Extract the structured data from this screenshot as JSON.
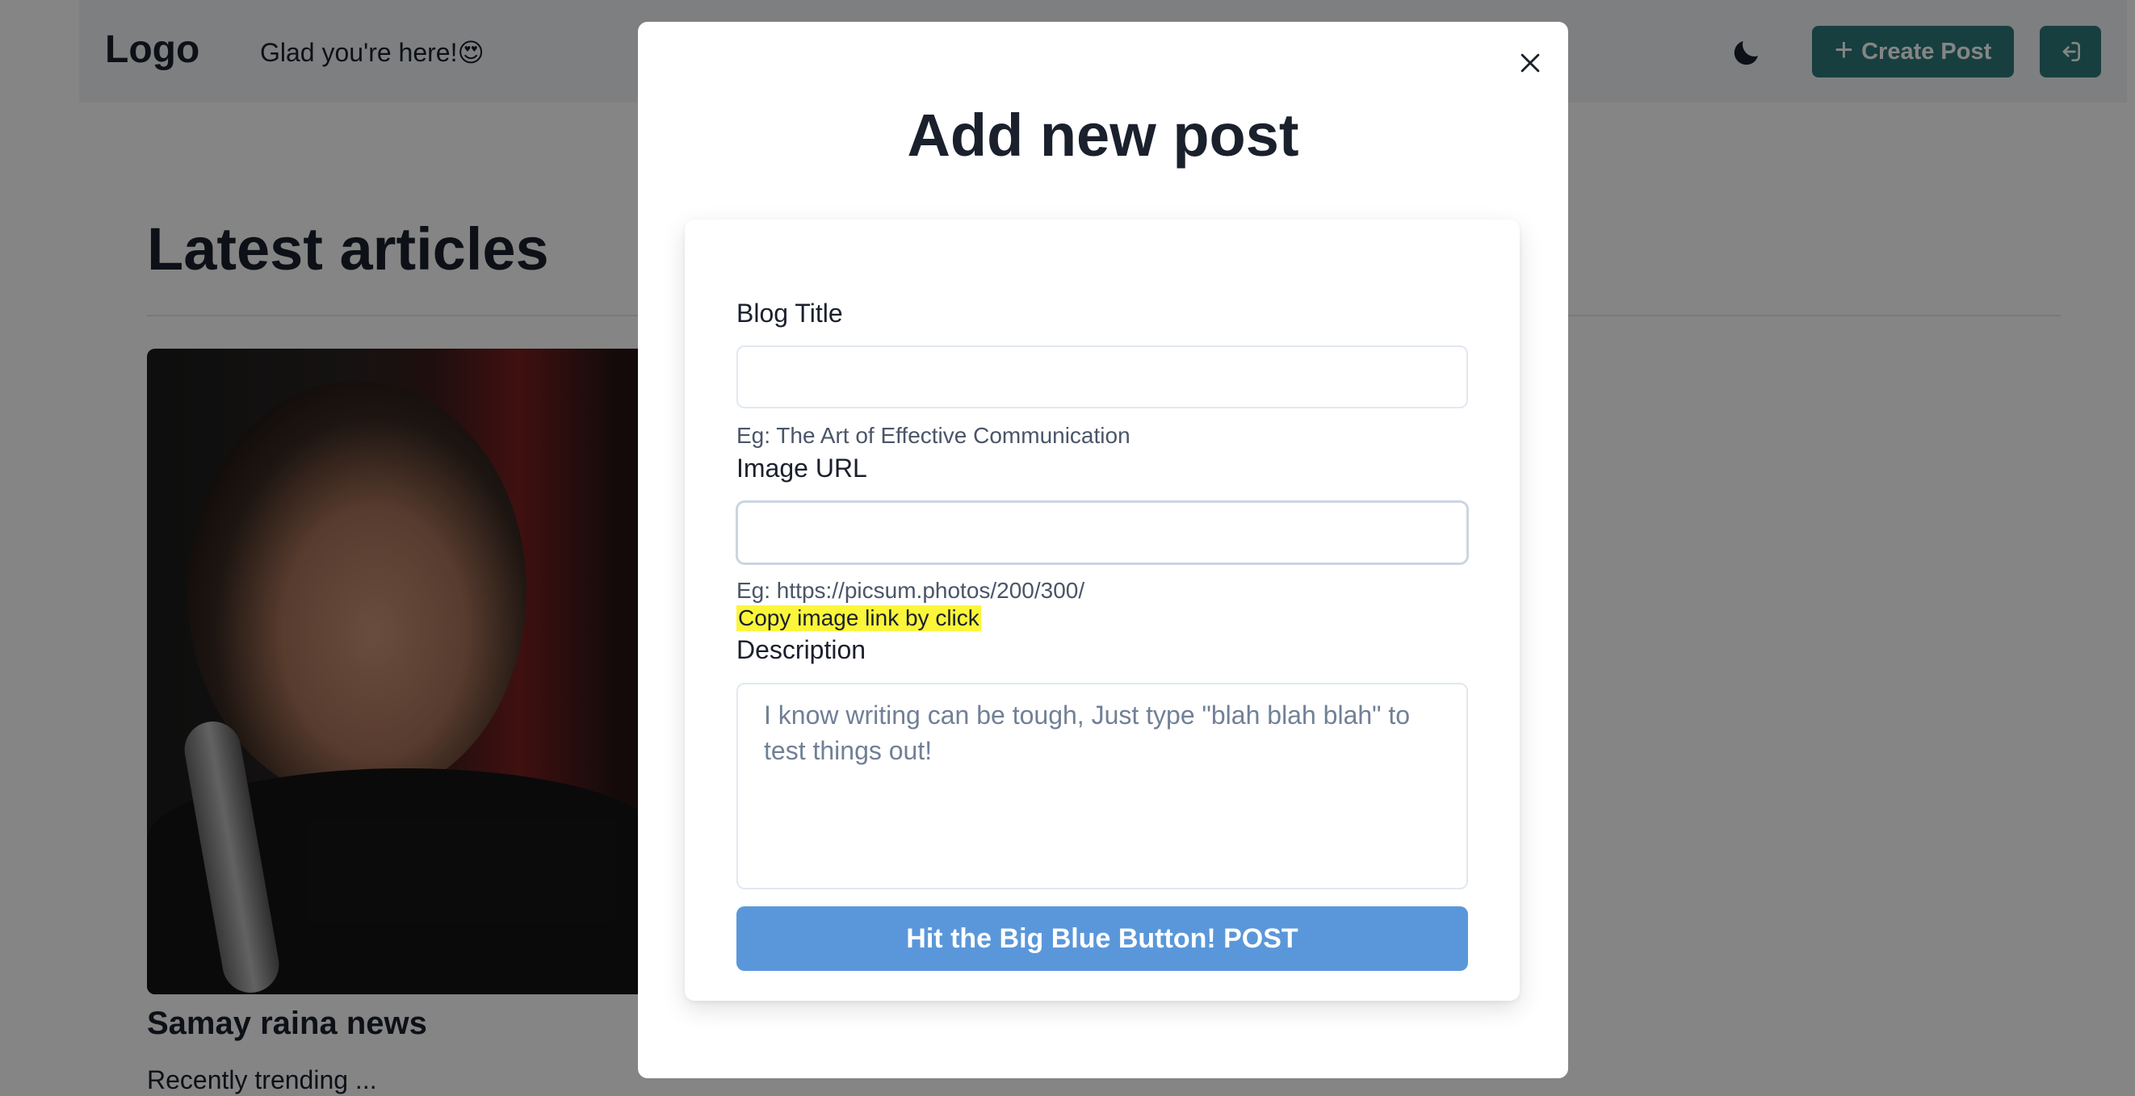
{
  "navbar": {
    "logo": "Logo",
    "greeting": "Glad you're here!😍",
    "theme_toggle_icon": "moon-icon",
    "create_post_label": "Create Post",
    "create_post_icon": "plus-icon",
    "logout_icon": "logout-icon",
    "accent_color": "#2c7a7b"
  },
  "main": {
    "heading": "Latest articles",
    "articles": [
      {
        "title": "Samay raina news",
        "excerpt": "Recently trending ..."
      }
    ]
  },
  "modal": {
    "title": "Add new post",
    "close_icon": "close-icon",
    "form": {
      "blog_title": {
        "label": "Blog Title",
        "value": "",
        "hint": "Eg: The Art of Effective Communication"
      },
      "image_url": {
        "label": "Image URL",
        "value": "",
        "hint": "Eg: https://picsum.photos/200/300/",
        "copy_link": "Copy image link by click"
      },
      "description": {
        "label": "Description",
        "value": "",
        "placeholder": "I know writing can be tough, Just type \"blah blah blah\" to test things out!"
      },
      "submit_label": "Hit the Big Blue Button! POST",
      "submit_color": "#5a97da"
    }
  }
}
